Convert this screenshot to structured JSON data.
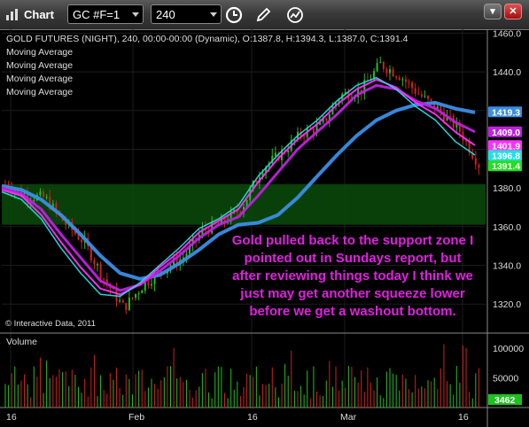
{
  "toolbar": {
    "app_title": "Chart",
    "symbol": "GC #F=1",
    "interval": "240",
    "accent": "#5a5a5a"
  },
  "header": {
    "instrument_line": "GOLD FUTURES (NIGHT), 240, 00:00-00:00 (Dynamic), O:1387.8, H:1394.3, L:1387.0, C:1391.4",
    "indicators": [
      "Moving Average",
      "Moving Average",
      "Moving Average",
      "Moving Average"
    ]
  },
  "annotation": "Gold pulled back to the support zone I pointed out in Sundays report, but after reviewing things today I think we just may get another squeeze lower before we get a washout bottom.",
  "copyright": "© Interactive Data, 2011",
  "volume_panel": {
    "label": "Volume",
    "ticks": [
      "100000",
      "50000"
    ],
    "last_value": "3462"
  },
  "chart_data": {
    "type": "candlestick",
    "ylim": [
      1305,
      1462
    ],
    "yticks": [
      1320,
      1340,
      1360,
      1380,
      1400,
      1420,
      1440,
      1460
    ],
    "ytick_labels": [
      "1320.0",
      "1340.0",
      "1360.0",
      "1380.0",
      "1400.0",
      "1420.0",
      "1440.0",
      "1460.0"
    ],
    "x_labels": [
      "16",
      "Feb",
      "16",
      "Mar",
      "16"
    ],
    "support_zone": [
      1361,
      1382
    ],
    "last_close": 1391.4,
    "price_anchors": [
      1382,
      1376,
      1375,
      1362,
      1352,
      1333,
      1318,
      1330,
      1338,
      1344,
      1358,
      1362,
      1370,
      1390,
      1398,
      1408,
      1412,
      1428,
      1430,
      1444,
      1438,
      1428,
      1420,
      1410,
      1392
    ],
    "ma_tags": [
      {
        "value": 1419.3,
        "label": "1419.3",
        "color": "#3a8ee6"
      },
      {
        "value": 1409.0,
        "label": "1409.0",
        "color": "#c020e0"
      },
      {
        "value": 1401.9,
        "label": "1401.9",
        "color": "#ff30ff"
      },
      {
        "value": 1396.8,
        "label": "1396.8",
        "color": "#20e0e0"
      },
      {
        "value": 1391.4,
        "label": "1391.4",
        "color": "#20e020"
      }
    ],
    "series": [
      {
        "name": "Moving Average",
        "color": "#3a8ee6",
        "values": [
          1381,
          1379,
          1374,
          1366,
          1356,
          1345,
          1336,
          1333,
          1335,
          1341,
          1348,
          1356,
          1361,
          1362,
          1366,
          1375,
          1386,
          1397,
          1407,
          1415,
          1420,
          1423,
          1424,
          1421,
          1419
        ]
      },
      {
        "name": "Moving Average",
        "color": "#c020e0",
        "values": [
          1380,
          1377,
          1369,
          1356,
          1344,
          1332,
          1327,
          1330,
          1337,
          1345,
          1354,
          1361,
          1365,
          1376,
          1388,
          1400,
          1409,
          1418,
          1428,
          1433,
          1431,
          1425,
          1421,
          1414,
          1409
        ]
      },
      {
        "name": "Moving Average",
        "color": "#ff30ff",
        "values": [
          1379,
          1376,
          1366,
          1352,
          1339,
          1328,
          1325,
          1330,
          1339,
          1347,
          1357,
          1363,
          1369,
          1383,
          1395,
          1405,
          1413,
          1423,
          1431,
          1436,
          1432,
          1424,
          1418,
          1409,
          1402
        ]
      },
      {
        "name": "Moving Average",
        "color": "#20e0e0",
        "values": [
          1378,
          1374,
          1364,
          1349,
          1336,
          1325,
          1324,
          1331,
          1340,
          1349,
          1359,
          1364,
          1371,
          1386,
          1397,
          1407,
          1415,
          1425,
          1433,
          1437,
          1431,
          1422,
          1415,
          1404,
          1397
        ]
      }
    ],
    "volume_ylim": [
      0,
      125000
    ]
  }
}
